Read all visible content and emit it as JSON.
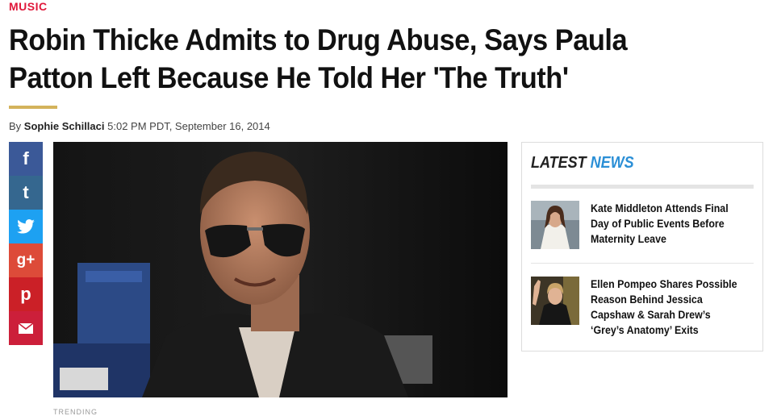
{
  "article": {
    "category": "MUSIC",
    "headline": "Robin Thicke Admits to Drug Abuse, Says Paula Patton Left Because He Told Her 'The Truth'",
    "byline_prefix": "By",
    "author": "Sophie Schillaci",
    "timestamp": "5:02 PM PDT, September 16, 2014"
  },
  "share": {
    "facebook": "f",
    "tumblr": "t",
    "twitter": "twitter-icon",
    "googleplus": "g+",
    "pinterest": "p",
    "email": "email-icon"
  },
  "sidebar": {
    "title_part1": "LATEST",
    "title_part2": "NEWS",
    "items": [
      {
        "title": "Kate Middleton Attends Final Day of Public Events Before Maternity Leave"
      },
      {
        "title": "Ellen Pompeo Shares Possible Reason Behind Jessica Capshaw & Sarah Drew’s ‘Grey’s Anatomy’ Exits"
      }
    ]
  },
  "below_video": "TRENDING",
  "colors": {
    "category": "#e0173a",
    "accent_gold": "#d4b35c",
    "news_blue": "#2b8fd6"
  }
}
